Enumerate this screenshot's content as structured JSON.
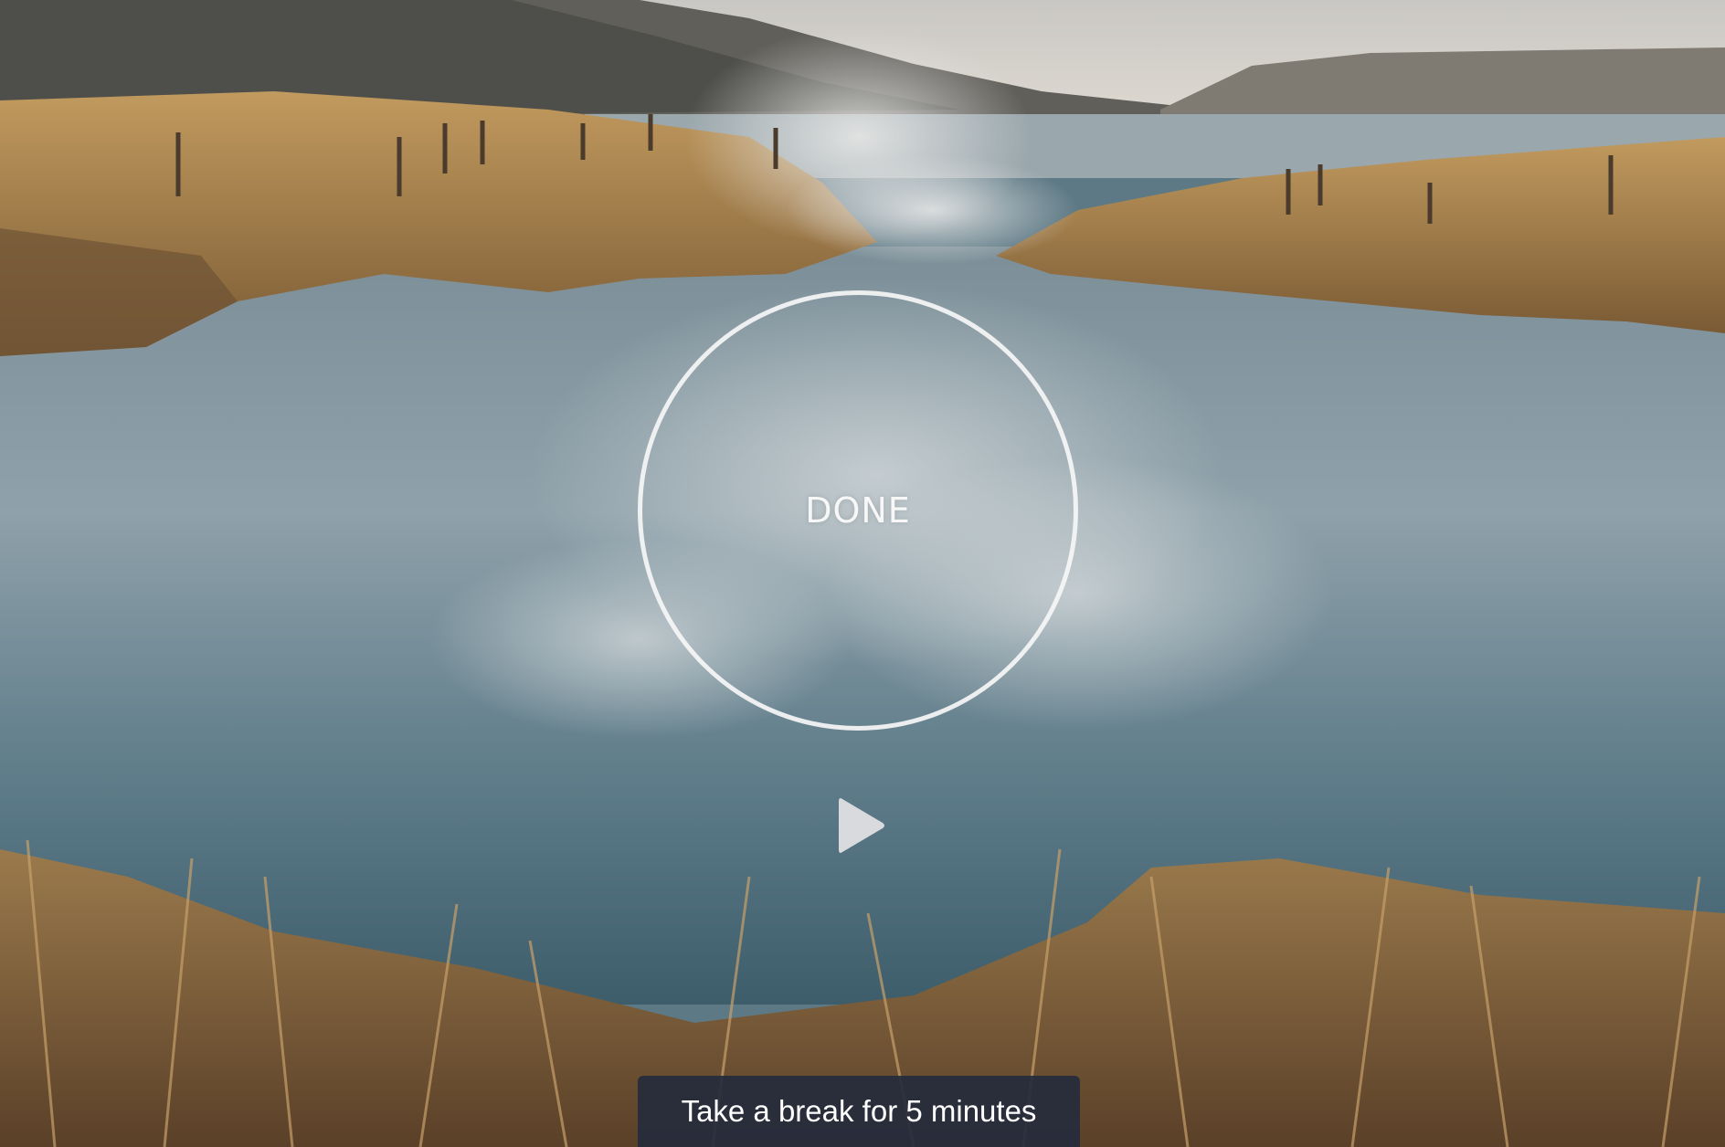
{
  "background": {
    "icon": "landscape-photo",
    "colors": {
      "sky": "#d9d7d2",
      "mountains": "#6e6c66",
      "water": "#6f8b97",
      "grass": "#b08a52"
    }
  },
  "timer": {
    "label": "DONE",
    "ring_color": "#f6f6f6"
  },
  "controls": {
    "play_icon": "play-icon",
    "icon_color": "#d8dadd"
  },
  "message": {
    "text": "Take a break for 5 minutes",
    "background": "#262c3c"
  }
}
